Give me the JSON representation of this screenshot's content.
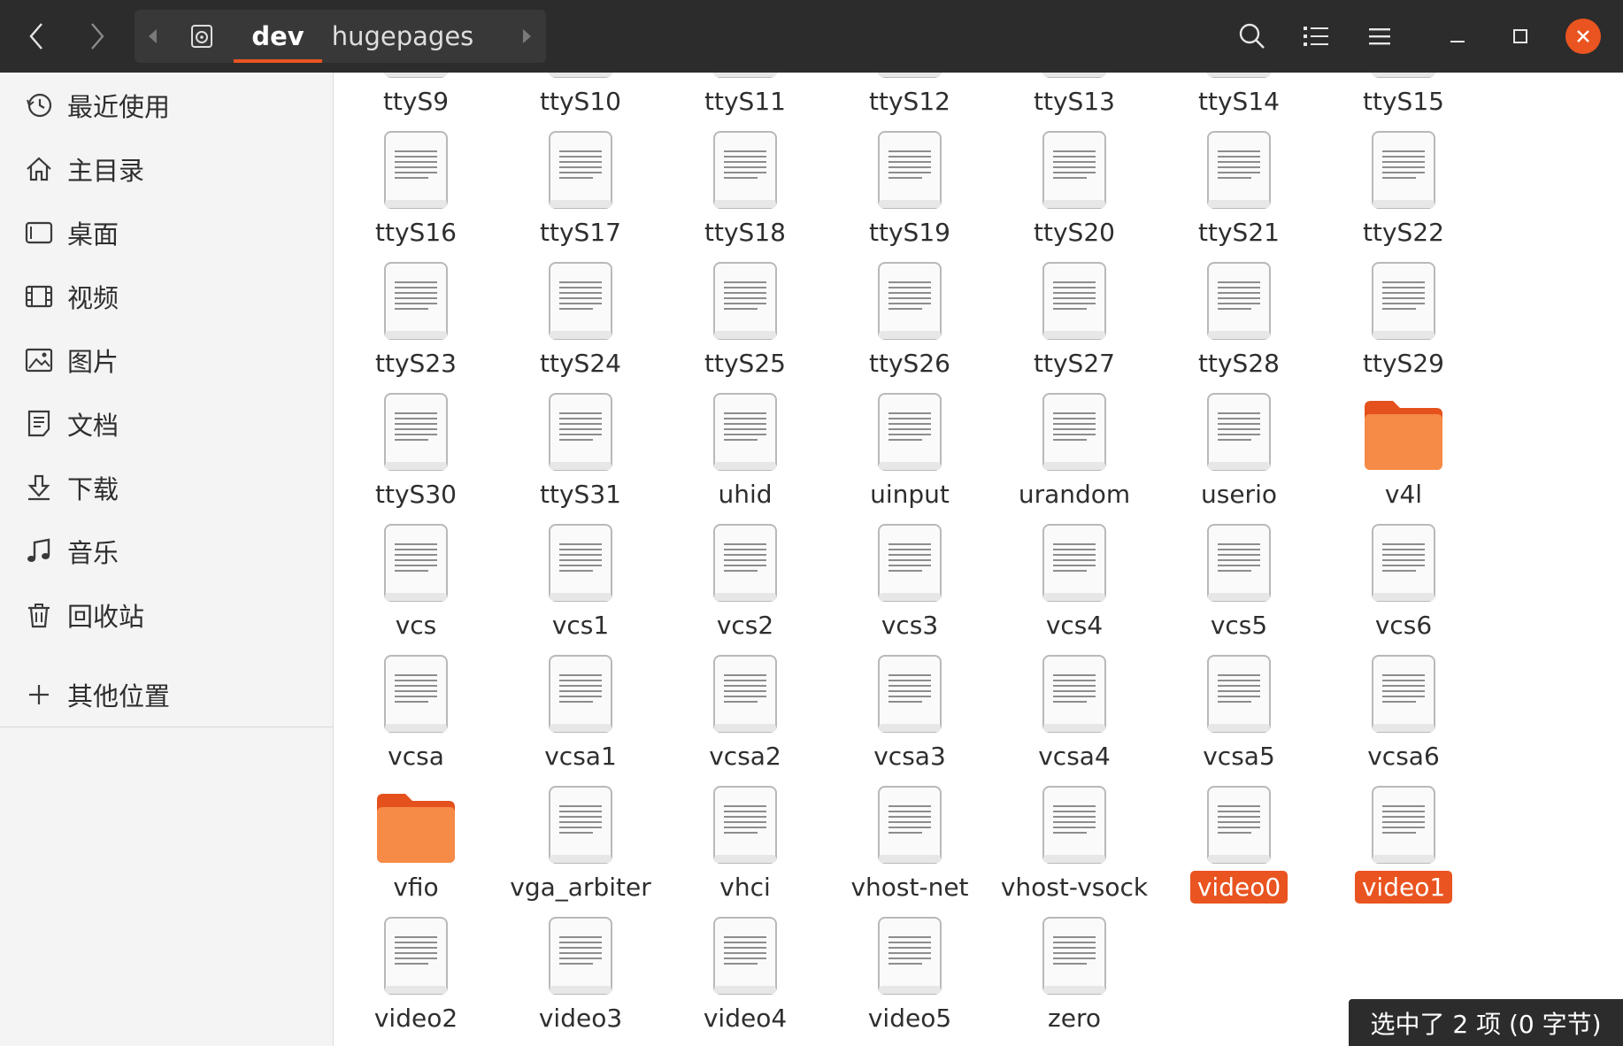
{
  "window": {
    "path_segments": [
      "dev",
      "hugepages"
    ],
    "active_segment": "dev"
  },
  "sidebar": {
    "items": [
      {
        "label": "最近使用",
        "icon": "clock-icon"
      },
      {
        "label": "主目录",
        "icon": "home-icon"
      },
      {
        "label": "桌面",
        "icon": "desktop-icon"
      },
      {
        "label": "视频",
        "icon": "video-icon"
      },
      {
        "label": "图片",
        "icon": "picture-icon"
      },
      {
        "label": "文档",
        "icon": "document-icon"
      },
      {
        "label": "下载",
        "icon": "download-icon"
      },
      {
        "label": "音乐",
        "icon": "music-icon"
      },
      {
        "label": "回收站",
        "icon": "trash-icon"
      }
    ],
    "other_locations": {
      "label": "其他位置",
      "icon": "plus-icon"
    }
  },
  "files": [
    {
      "name": "ttyS9",
      "type": "file"
    },
    {
      "name": "ttyS10",
      "type": "file"
    },
    {
      "name": "ttyS11",
      "type": "file"
    },
    {
      "name": "ttyS12",
      "type": "file"
    },
    {
      "name": "ttyS13",
      "type": "file"
    },
    {
      "name": "ttyS14",
      "type": "file"
    },
    {
      "name": "ttyS15",
      "type": "file"
    },
    {
      "name": "ttyS16",
      "type": "file"
    },
    {
      "name": "ttyS17",
      "type": "file"
    },
    {
      "name": "ttyS18",
      "type": "file"
    },
    {
      "name": "ttyS19",
      "type": "file"
    },
    {
      "name": "ttyS20",
      "type": "file"
    },
    {
      "name": "ttyS21",
      "type": "file"
    },
    {
      "name": "ttyS22",
      "type": "file"
    },
    {
      "name": "ttyS23",
      "type": "file"
    },
    {
      "name": "ttyS24",
      "type": "file"
    },
    {
      "name": "ttyS25",
      "type": "file"
    },
    {
      "name": "ttyS26",
      "type": "file"
    },
    {
      "name": "ttyS27",
      "type": "file"
    },
    {
      "name": "ttyS28",
      "type": "file"
    },
    {
      "name": "ttyS29",
      "type": "file"
    },
    {
      "name": "ttyS30",
      "type": "file"
    },
    {
      "name": "ttyS31",
      "type": "file"
    },
    {
      "name": "uhid",
      "type": "file"
    },
    {
      "name": "uinput",
      "type": "file"
    },
    {
      "name": "urandom",
      "type": "file"
    },
    {
      "name": "userio",
      "type": "file"
    },
    {
      "name": "v4l",
      "type": "folder"
    },
    {
      "name": "vcs",
      "type": "file"
    },
    {
      "name": "vcs1",
      "type": "file"
    },
    {
      "name": "vcs2",
      "type": "file"
    },
    {
      "name": "vcs3",
      "type": "file"
    },
    {
      "name": "vcs4",
      "type": "file"
    },
    {
      "name": "vcs5",
      "type": "file"
    },
    {
      "name": "vcs6",
      "type": "file"
    },
    {
      "name": "vcsa",
      "type": "file"
    },
    {
      "name": "vcsa1",
      "type": "file"
    },
    {
      "name": "vcsa2",
      "type": "file"
    },
    {
      "name": "vcsa3",
      "type": "file"
    },
    {
      "name": "vcsa4",
      "type": "file"
    },
    {
      "name": "vcsa5",
      "type": "file"
    },
    {
      "name": "vcsa6",
      "type": "file"
    },
    {
      "name": "vfio",
      "type": "folder"
    },
    {
      "name": "vga_arbiter",
      "type": "file"
    },
    {
      "name": "vhci",
      "type": "file"
    },
    {
      "name": "vhost-net",
      "type": "file"
    },
    {
      "name": "vhost-vsock",
      "type": "file"
    },
    {
      "name": "video0",
      "type": "file",
      "selected": true
    },
    {
      "name": "video1",
      "type": "file",
      "selected": true
    },
    {
      "name": "video2",
      "type": "file"
    },
    {
      "name": "video3",
      "type": "file"
    },
    {
      "name": "video4",
      "type": "file"
    },
    {
      "name": "video5",
      "type": "file"
    },
    {
      "name": "zero",
      "type": "file"
    }
  ],
  "status": "选中了 2 项 (0 字节)",
  "colors": {
    "accent": "#e95420",
    "headerbar": "#2c2c2c",
    "sidebar": "#f4f4f4",
    "folder": "#f68a47"
  }
}
